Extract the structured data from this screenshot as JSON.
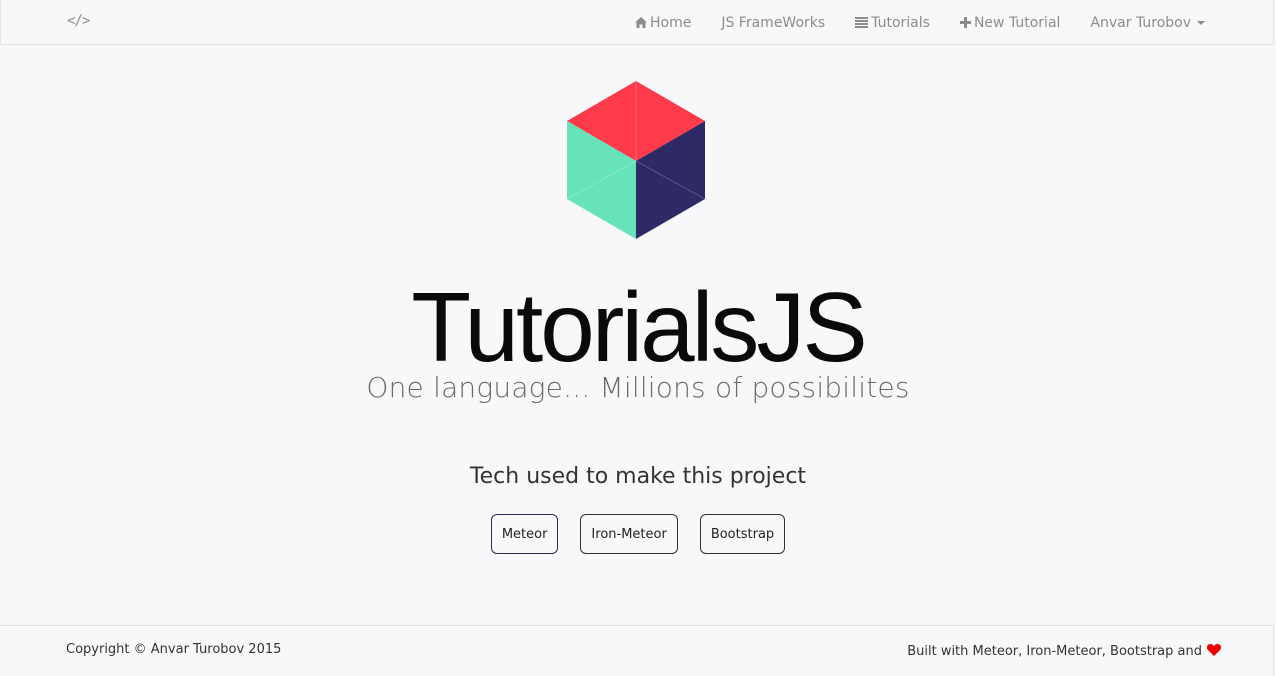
{
  "navbar": {
    "brand_icon": "code-icon",
    "brand_glyph": "</>",
    "items": [
      {
        "label": "Home",
        "icon": "home-icon"
      },
      {
        "label": "JS FrameWorks",
        "icon": ""
      },
      {
        "label": "Tutorials",
        "icon": "list-icon"
      },
      {
        "label": "New Tutorial",
        "icon": "plus-icon"
      },
      {
        "label": "Anvar Turobov",
        "icon": "caret-down-icon"
      }
    ]
  },
  "hero": {
    "title": "TutorialsJS",
    "tagline": "One language... Millions of possibilites",
    "logo_colors": {
      "top": "#ff3a4a",
      "left": "#66e3b8",
      "right": "#2e2a66"
    }
  },
  "tech": {
    "heading": "Tech used to make this project",
    "buttons": [
      "Meteor",
      "Iron-Meteor",
      "Bootstrap"
    ]
  },
  "footer": {
    "copyright": "Copyright © Anvar Turobov 2015",
    "built_with": "Built with Meteor, Iron-Meteor, Bootstrap and",
    "heart_icon": "heart-icon"
  },
  "colors": {
    "accent_border": "#2b2a5e",
    "heart": "#ee0000",
    "nav_text": "#8c8c8c"
  }
}
